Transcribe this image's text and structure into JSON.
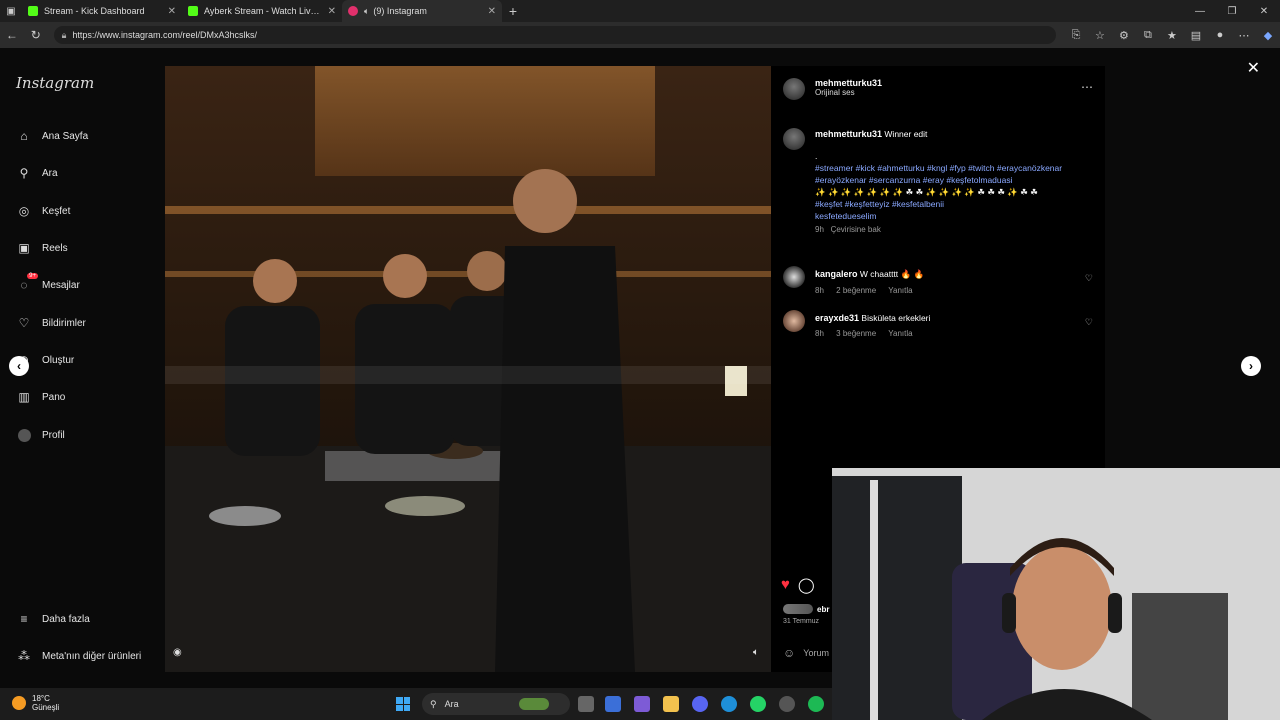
{
  "browser": {
    "tabs": [
      {
        "title": "Stream - Kick Dashboard",
        "color": "#53fc18",
        "active": false
      },
      {
        "title": "Ayberk Stream - Watch Live on Ki",
        "color": "#53fc18",
        "active": false
      },
      {
        "title": "(9) Instagram",
        "color": "#e1306c",
        "active": true,
        "muted_icon": "speaker-icon"
      }
    ],
    "url": "https://www.instagram.com/reel/DMxA3hcslks/"
  },
  "sidebar": {
    "logo": "Instagram",
    "items": [
      {
        "label": "Ana Sayfa",
        "icon": "home-icon"
      },
      {
        "label": "Ara",
        "icon": "search-icon"
      },
      {
        "label": "Keşfet",
        "icon": "compass-icon"
      },
      {
        "label": "Reels",
        "icon": "reels-icon"
      },
      {
        "label": "Mesajlar",
        "icon": "messenger-icon",
        "badge": "9+"
      },
      {
        "label": "Bildirimler",
        "icon": "heart-icon"
      },
      {
        "label": "Oluştur",
        "icon": "plus-icon"
      },
      {
        "label": "Pano",
        "icon": "dashboard-icon"
      },
      {
        "label": "Profil",
        "icon": "avatar-icon"
      }
    ],
    "more": "Daha fazla",
    "meta": "Meta'nın diğer ürünleri"
  },
  "post": {
    "author": "mehmetturku31",
    "audio": "Orijinal ses",
    "caption_user": "mehmetturku31",
    "caption_text": "Winner edit",
    "caption_dot": ".",
    "tags": "#streamer #kick #ahmetturku #kngl #fyp #twitch #eraycanözkenar #erayözkenar #sercanzurna #eray #keşfetolmaduasi",
    "emoji_line": "✨ ✨ ✨ ✨ ✨ ✨ ✨ ☘ ☘ ✨ ✨ ✨ ✨ ☘ ☘ ☘ ✨ ☘ ☘",
    "tags2": "#keşfet #keşfetteyiz #kesfetalbenii",
    "tags3": "kesfetedueselim",
    "caption_time": "9h",
    "translate": "Çevirisine bak",
    "likers": "ebr",
    "date": "31 Temmuz",
    "comment_placeholder": "Yorum"
  },
  "comments": [
    {
      "user": "kangalero",
      "text": "W chaatttt 🔥 🔥",
      "time": "8h",
      "likes": "2 beğenme",
      "reply": "Yanıtla"
    },
    {
      "user": "erayxde31",
      "text": "Biskületa erkekleri",
      "time": "8h",
      "likes": "3 beğenme",
      "reply": "Yanıtla"
    }
  ],
  "taskbar": {
    "temp": "18°C",
    "weather": "Güneşli",
    "search": "Ara"
  }
}
